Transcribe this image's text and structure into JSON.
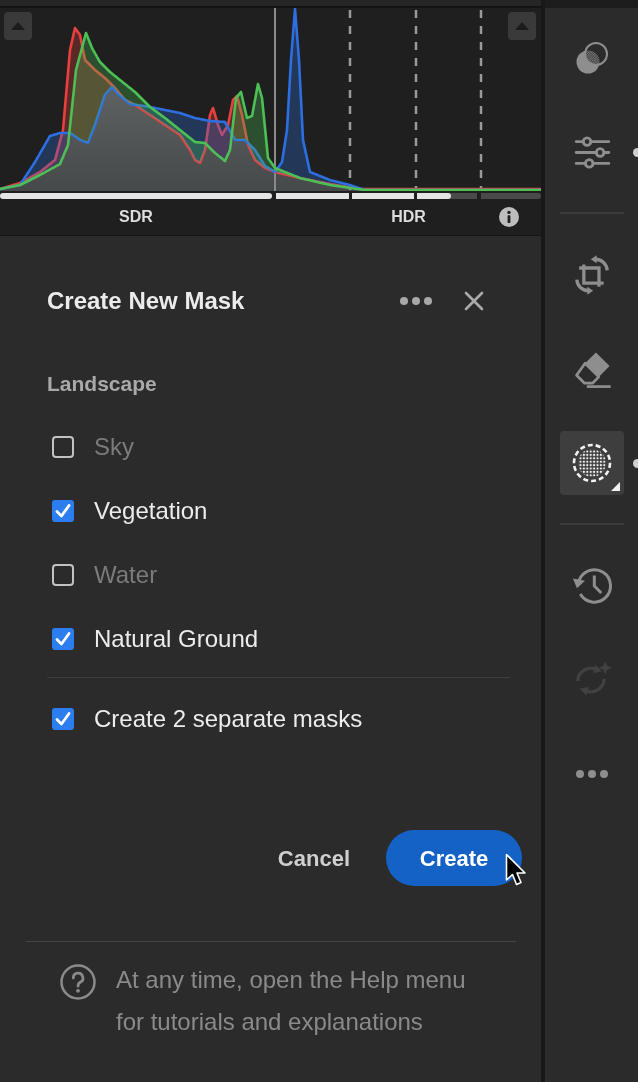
{
  "histogram": {
    "hdr_headroom": {
      "level": 0.66
    },
    "scale_labels": [
      "SDR",
      "HDR"
    ]
  },
  "dialog": {
    "title": "Create New Mask",
    "section_title": "Landscape",
    "options": [
      {
        "label": "Sky",
        "checked": false
      },
      {
        "label": "Vegetation",
        "checked": true
      },
      {
        "label": "Water",
        "checked": false
      },
      {
        "label": "Natural Ground",
        "checked": true
      }
    ],
    "separate_masks": {
      "label": "Create 2 separate masks",
      "checked": true
    },
    "buttons": [
      {
        "label": "Cancel",
        "kind": "secondary"
      },
      {
        "label": "Create",
        "kind": "primary"
      }
    ],
    "help_text": "At any time, open the Help menu for tutorials and explanations"
  },
  "toolbar": {
    "groups": [
      {
        "tools": [
          {
            "selected": false,
            "disabled": false,
            "edited": false
          },
          {
            "selected": false,
            "disabled": false,
            "edited": true
          }
        ]
      },
      {
        "tools": [
          {
            "selected": false,
            "disabled": false,
            "edited": false
          },
          {
            "selected": false,
            "disabled": false,
            "edited": false
          },
          {
            "selected": true,
            "disabled": false,
            "edited": true
          }
        ]
      },
      {
        "tools": [
          {
            "selected": false,
            "disabled": false,
            "edited": false
          },
          {
            "selected": false,
            "disabled": true,
            "edited": false
          },
          {
            "selected": false,
            "disabled": false,
            "edited": false
          }
        ]
      }
    ]
  }
}
